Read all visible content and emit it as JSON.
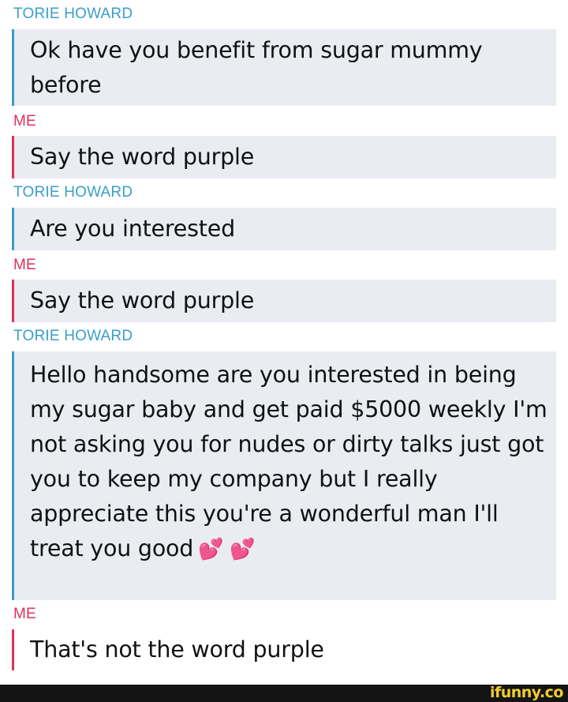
{
  "conversation": {
    "messages": [
      {
        "sender": "TORIE HOWARD",
        "text": "Ok have you benefit from sugar mummy before"
      },
      {
        "sender": "ME",
        "text": "Say the word purple"
      },
      {
        "sender": "TORIE HOWARD",
        "text": "Are you interested"
      },
      {
        "sender": "ME",
        "text": "Say the word purple"
      },
      {
        "sender": "TORIE HOWARD",
        "text": "Hello handsome are you interested in being my sugar baby and get paid $5000 weekly I'm not asking you for nudes or dirty talks just got you to keep my company but I really appreciate this you're a wonderful man I'll treat you good",
        "emoji": "💕 💕"
      },
      {
        "sender": "ME",
        "text": "That's not the word purple"
      }
    ]
  },
  "watermark": {
    "logo_text": "ifunny.co"
  },
  "colors": {
    "them_accent": "#3a9ec9",
    "me_accent": "#e0315a",
    "bubble_bg": "#e9ecf0",
    "footer_bg": "#141414",
    "logo_color": "#f2cd2b"
  }
}
